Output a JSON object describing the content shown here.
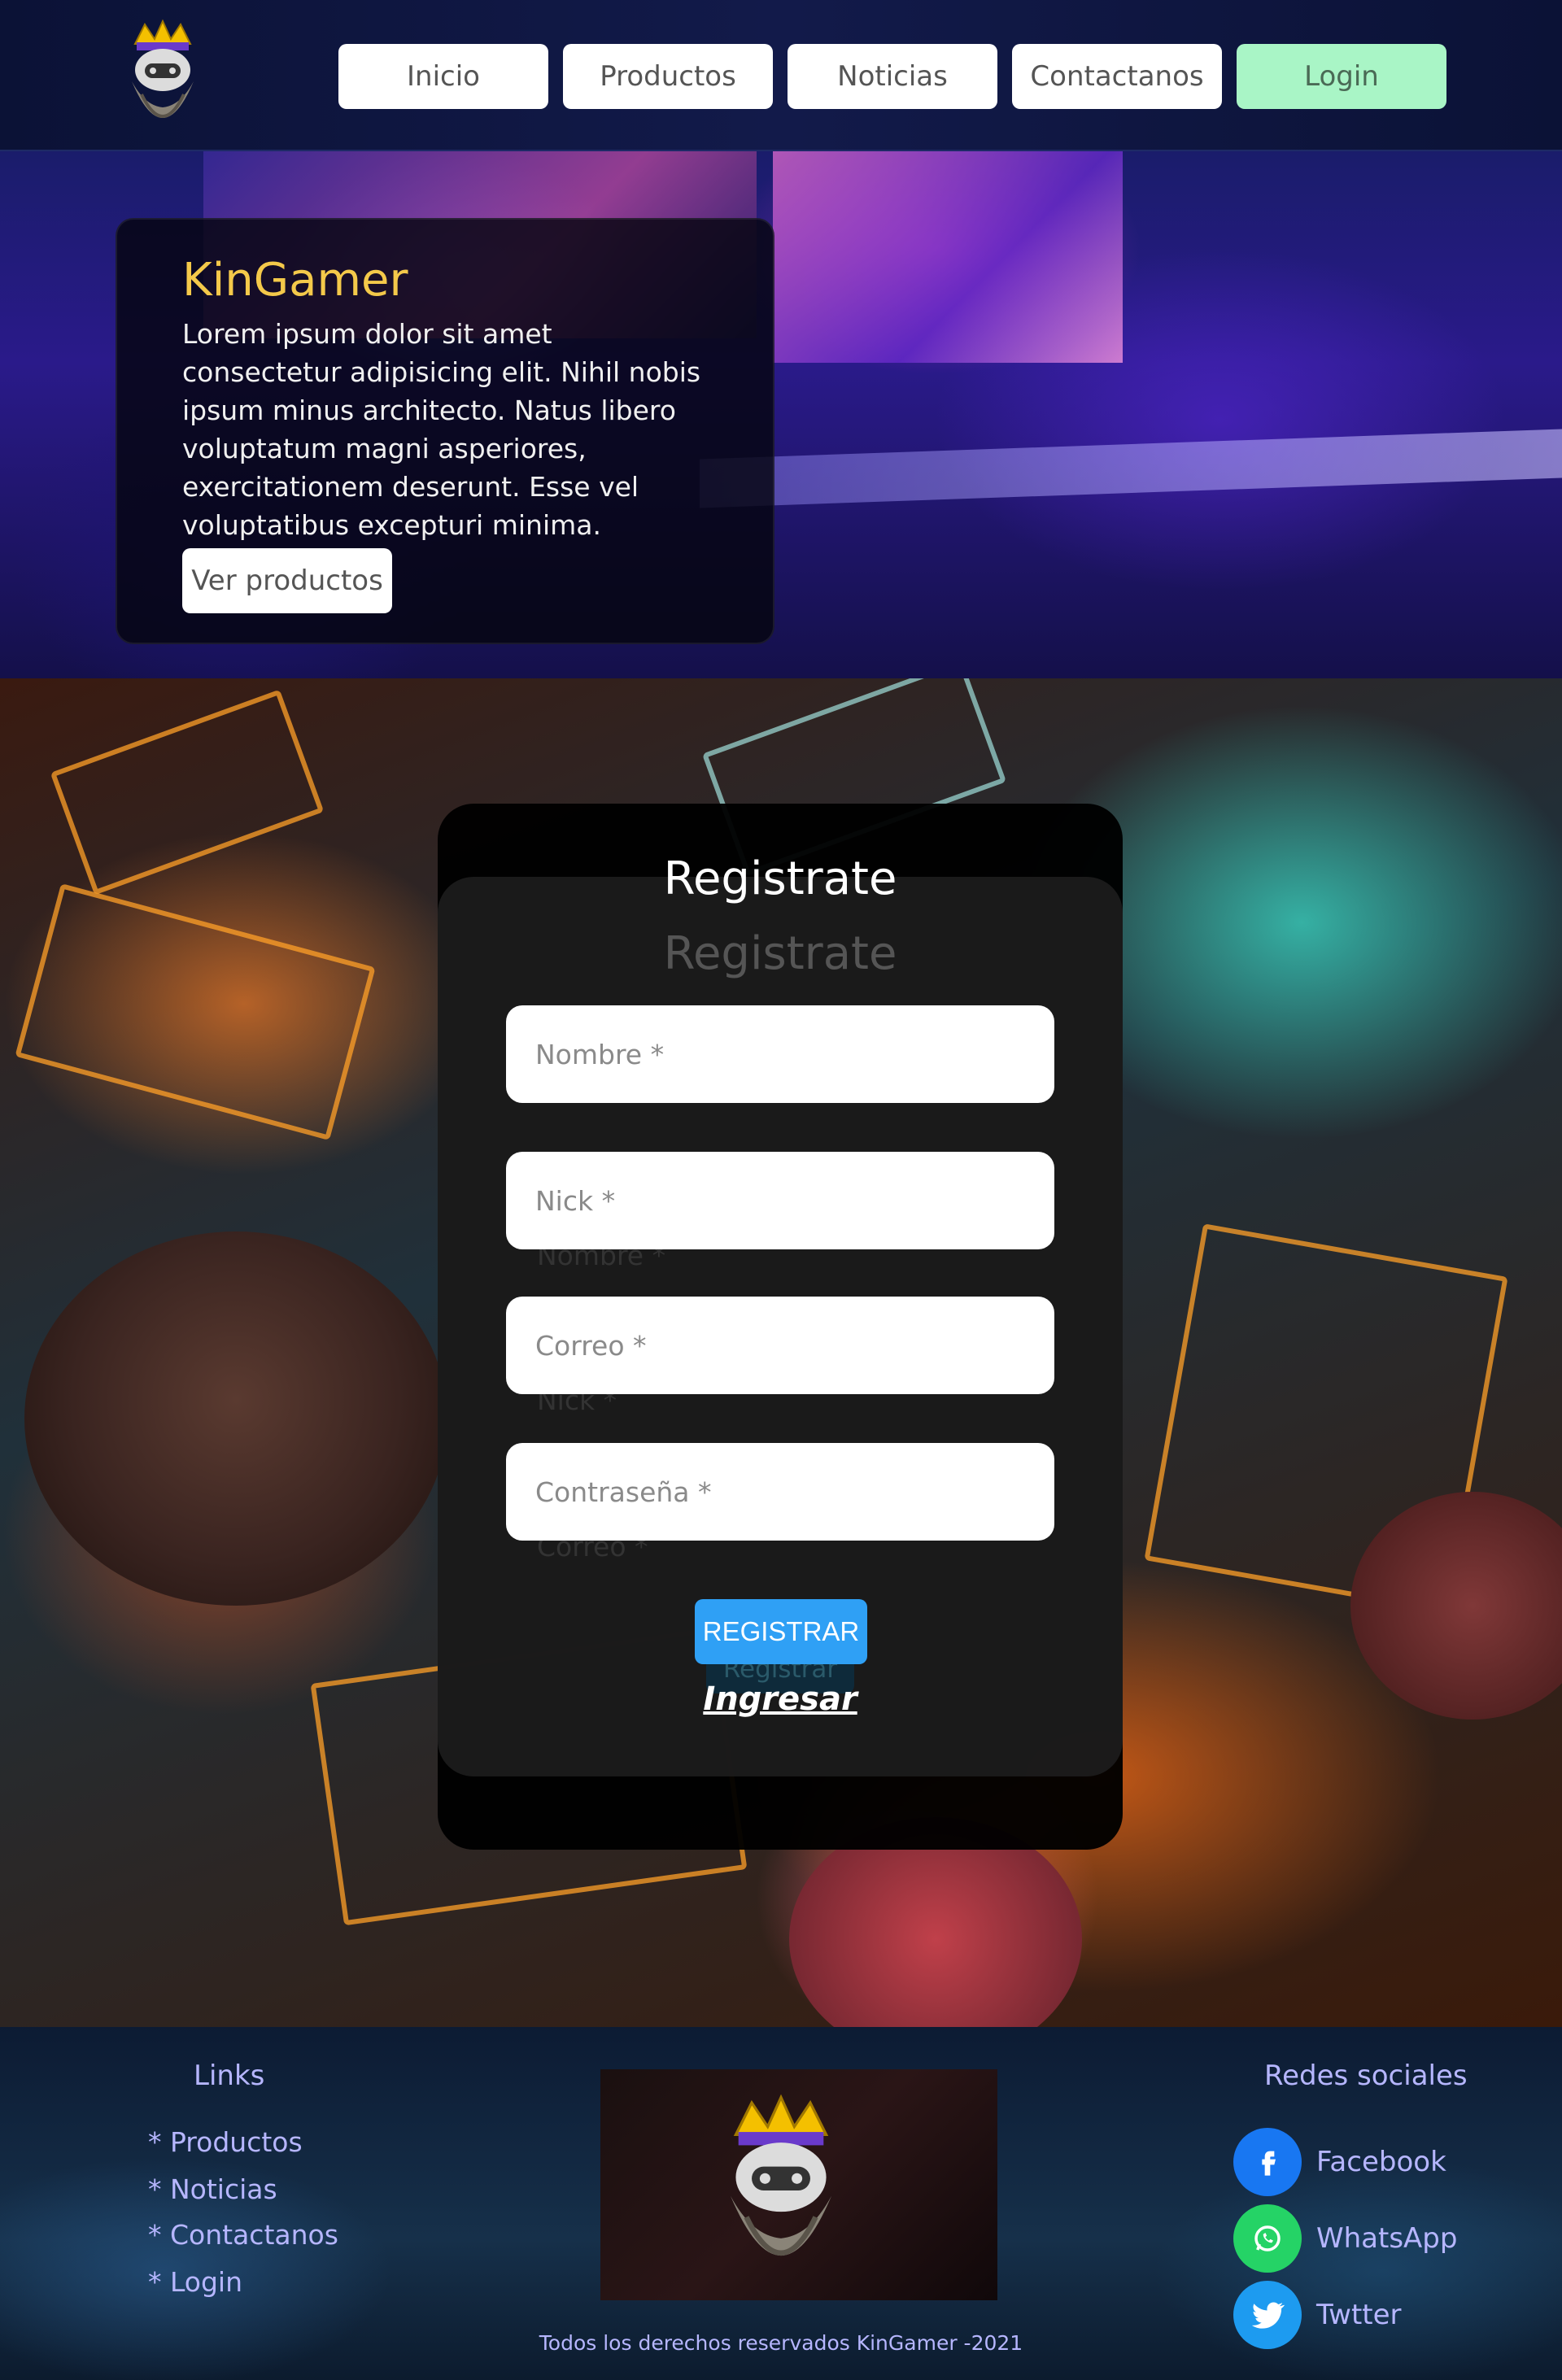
{
  "nav": {
    "items": [
      "Inicio",
      "Productos",
      "Noticias",
      "Contactanos"
    ],
    "login_label": "Login"
  },
  "hero": {
    "title": "KinGamer",
    "text": "Lorem ipsum dolor sit amet consectetur adipisicing elit. Nihil nobis ipsum minus architecto. Natus libero voluptatum magni asperiores, exercitationem deserunt. Esse vel voluptatibus excepturi minima.",
    "button_label": "Ver productos"
  },
  "register": {
    "title": "Registrate",
    "fields": {
      "name_placeholder": "Nombre *",
      "nick_placeholder": "Nick *",
      "email_placeholder": "Correo *",
      "password_placeholder": "Contraseña *"
    },
    "ghost_button_label": "Registrar",
    "submit_label": "REGISTRAR",
    "login_link": "Ingresar"
  },
  "footer": {
    "links_title": "Links",
    "links": [
      "* Productos",
      "* Noticias",
      "* Contactanos",
      "* Login"
    ],
    "social_title": "Redes sociales",
    "social": [
      {
        "label": "Facebook",
        "icon": "facebook-icon",
        "color": "#1877f2"
      },
      {
        "label": "WhatsApp",
        "icon": "whatsapp-icon",
        "color": "#25d366"
      },
      {
        "label": "Twtter",
        "icon": "twitter-icon",
        "color": "#1d9bf0"
      }
    ],
    "copyright": "Todos los derechos reservados KinGamer -2021"
  },
  "colors": {
    "accent_gold": "#f4c94a",
    "login_green": "#a9f5c6",
    "submit_blue": "#2fa0f5",
    "footer_text": "#b6b6ff"
  }
}
